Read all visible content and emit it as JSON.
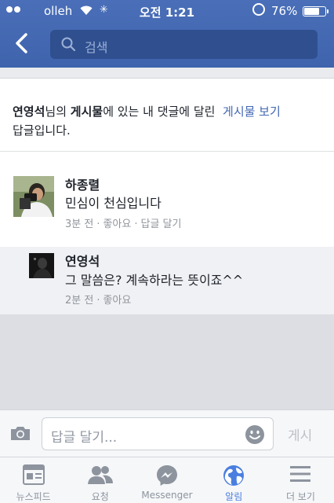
{
  "status_bar": {
    "carrier": "olleh",
    "time": "오전 1:21",
    "battery_pct": "76%",
    "battery_level": 0.76
  },
  "header": {
    "back_icon": "chevron-left-icon",
    "search_placeholder": "검색"
  },
  "notice": {
    "author": "연영석",
    "text1": "님의 ",
    "post_word": "게시물",
    "text2": "에 있는 내 댓글에 달린",
    "view_post_link": "게시물 보기",
    "text3": "답글입니다."
  },
  "comment": {
    "name": "하종렬",
    "text": "민심이 천심입니다",
    "time": "3분 전",
    "like": "좋아요",
    "reply": "답글 달기"
  },
  "reply": {
    "name": "연영석",
    "text": "그 말씀은? 계속하라는 뜻이죠^^",
    "time": "2분 전",
    "like": "좋아요"
  },
  "composer": {
    "placeholder": "답글 달기...",
    "post_label": "게시"
  },
  "tabs": [
    {
      "label": "뉴스피드",
      "icon": "newsfeed-icon"
    },
    {
      "label": "요청",
      "icon": "friend-requests-icon"
    },
    {
      "label": "Messenger",
      "icon": "messenger-icon"
    },
    {
      "label": "알림",
      "icon": "globe-icon",
      "active": true
    },
    {
      "label": "더 보기",
      "icon": "menu-icon"
    }
  ],
  "colors": {
    "brand_blue": "#4267b2",
    "active_tab": "#4a7fe0"
  }
}
